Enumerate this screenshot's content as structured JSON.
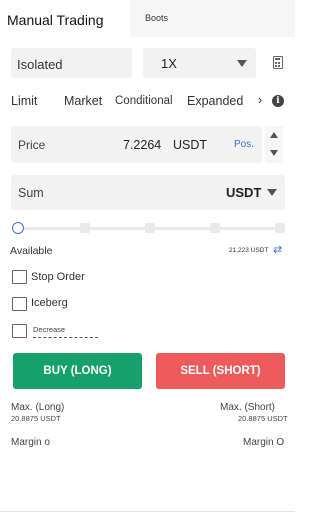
{
  "tabs": {
    "manual": "Manual Trading",
    "bots": "Boots"
  },
  "selectors": {
    "margin_mode": "Isolated",
    "leverage": "1X"
  },
  "icons": {
    "calculator": "calculator-icon",
    "info": "info-icon",
    "chevron": "chevron-right-icon",
    "swap": "swap-icon",
    "caret": "caret-down-icon"
  },
  "order_types": {
    "limit": "Limit",
    "market": "Market",
    "conditional": "Conditional",
    "expanded": "Expanded",
    "more": "›",
    "info": "i"
  },
  "price": {
    "label": "Price",
    "value": "7.2264",
    "unit": "USDT",
    "pos": "Pos."
  },
  "sum": {
    "label": "Sum",
    "unit": "USDT"
  },
  "slider": {
    "level": 0
  },
  "available": {
    "label": "Available",
    "value": "21,223 USDT",
    "swap_glyph": "⇄"
  },
  "options": {
    "stop_order": "Stop Order",
    "iceberg": "Iceberg",
    "decrease": "Decrease"
  },
  "buttons": {
    "buy": "BUY (LONG)",
    "sell": "SELL (SHORT)"
  },
  "max": {
    "long_label": "Max. (Long)",
    "long_value": "20.8875 USDT",
    "short_label": "Max. (Short)",
    "short_value": "20.8875 USDT"
  },
  "margin": {
    "left": "Margin o",
    "right": "Margin O"
  },
  "colors": {
    "buy": "#17a069",
    "sell": "#ee5b5c",
    "accent": "#3f6fd8"
  }
}
